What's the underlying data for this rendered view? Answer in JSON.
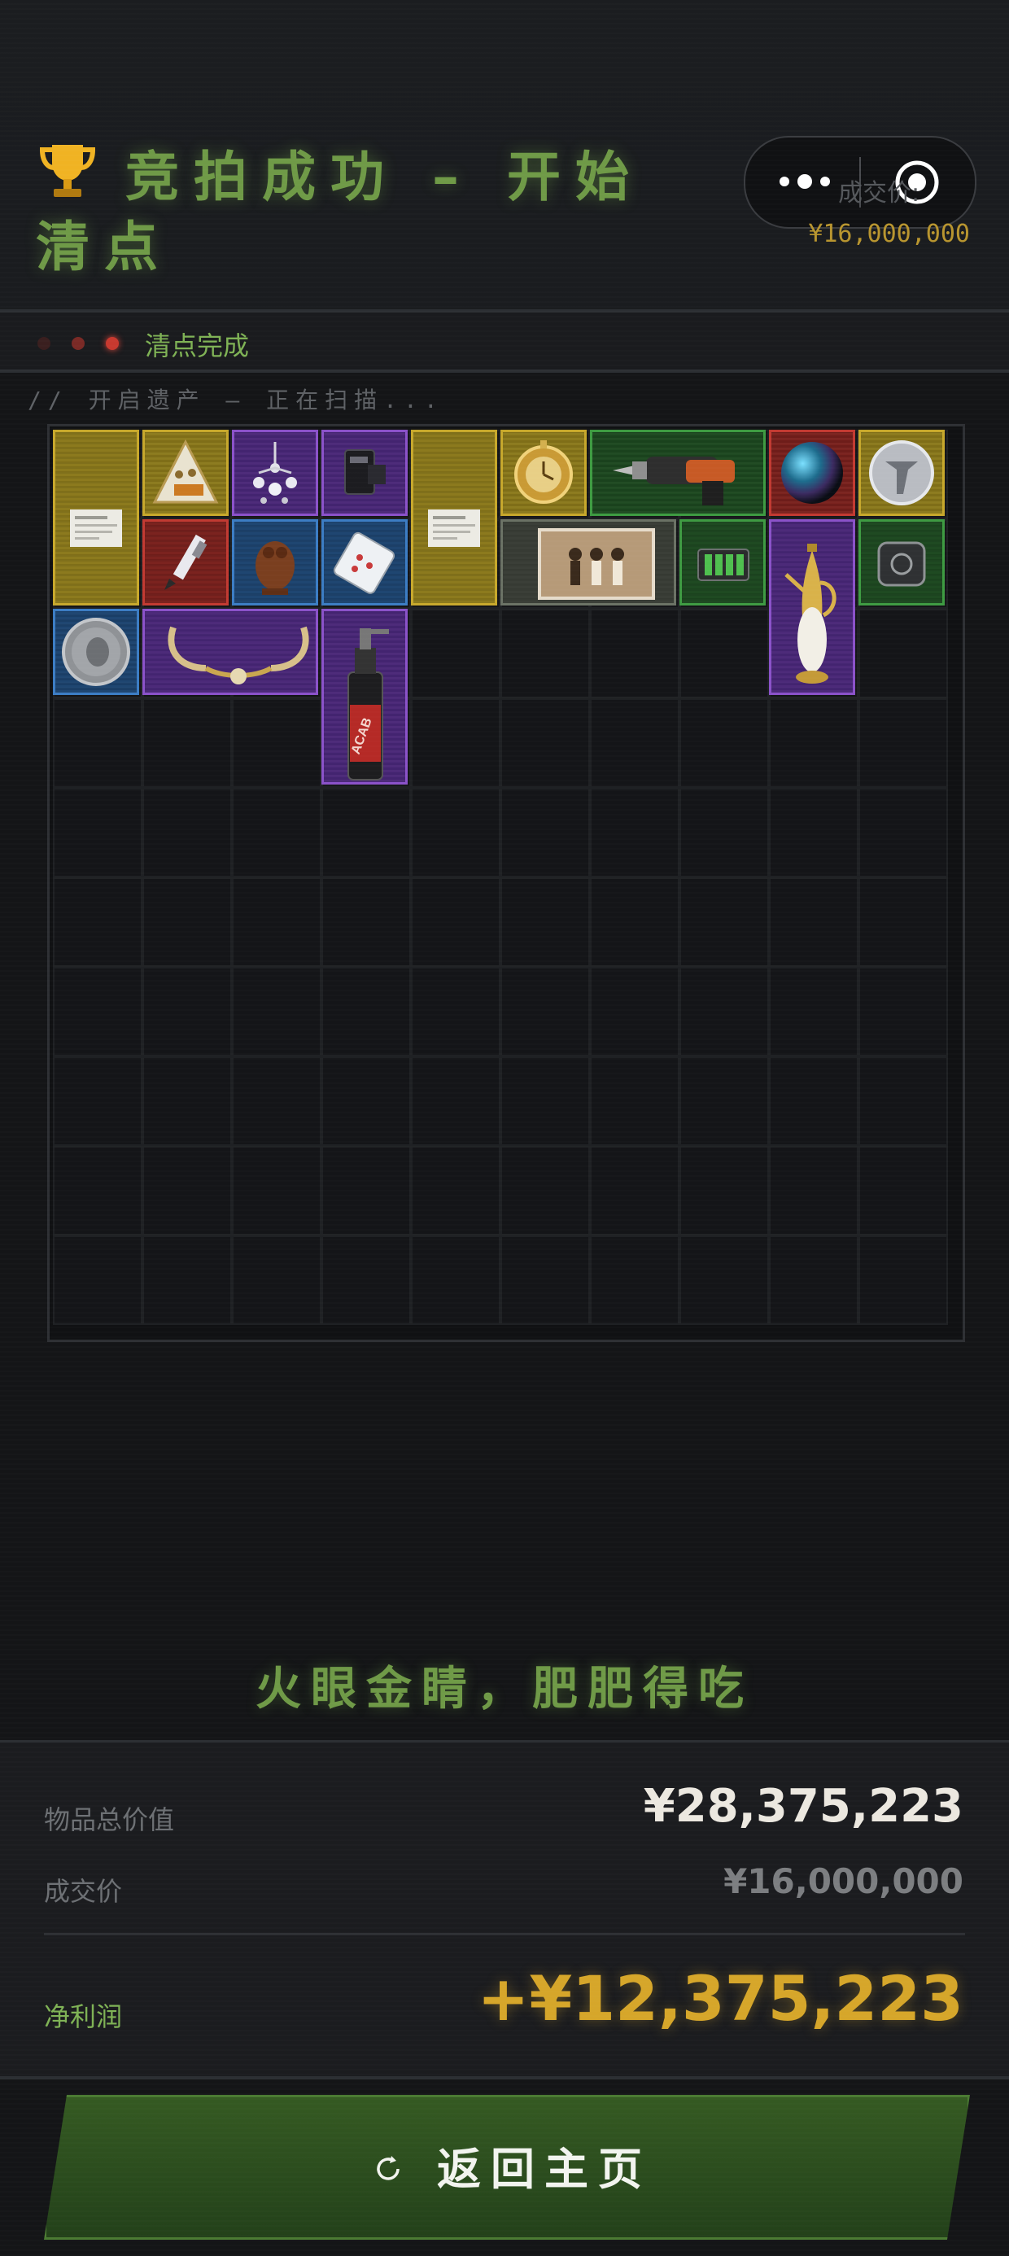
{
  "header": {
    "title": "竞拍成功 – 开始清点",
    "deal_label": "成交价:",
    "deal_value": "¥16,000,000"
  },
  "status": {
    "text": "清点完成",
    "scan_text": "// 开启遗产 – 正在扫描..."
  },
  "grid": {
    "columns": 10,
    "rows": 10,
    "items": [
      {
        "name": "document-item",
        "rarity": "gold",
        "col": 0,
        "row": 0,
        "w": 1,
        "h": 2,
        "icon": "document-icon"
      },
      {
        "name": "cookie-box-item",
        "rarity": "gold",
        "col": 1,
        "row": 0,
        "w": 1,
        "h": 1,
        "icon": "cookie-box-icon"
      },
      {
        "name": "earrings-item",
        "rarity": "purple",
        "col": 2,
        "row": 0,
        "w": 1,
        "h": 1,
        "icon": "earrings-icon"
      },
      {
        "name": "gadget-item",
        "rarity": "purple",
        "col": 3,
        "row": 0,
        "w": 1,
        "h": 1,
        "icon": "gadget-icon"
      },
      {
        "name": "document-item-2",
        "rarity": "gold",
        "col": 4,
        "row": 0,
        "w": 1,
        "h": 2,
        "icon": "document-icon"
      },
      {
        "name": "pocket-watch-item",
        "rarity": "gold",
        "col": 5,
        "row": 0,
        "w": 1,
        "h": 1,
        "icon": "pocket-watch-icon"
      },
      {
        "name": "power-drill-item",
        "rarity": "green",
        "col": 6,
        "row": 0,
        "w": 2,
        "h": 1,
        "icon": "power-drill-icon"
      },
      {
        "name": "orb-item",
        "rarity": "red",
        "col": 8,
        "row": 0,
        "w": 1,
        "h": 1,
        "icon": "orb-icon"
      },
      {
        "name": "silver-token-item",
        "rarity": "gold",
        "col": 9,
        "row": 0,
        "w": 1,
        "h": 1,
        "icon": "token-icon"
      },
      {
        "name": "fountain-pen-item",
        "rarity": "red",
        "col": 1,
        "row": 1,
        "w": 1,
        "h": 1,
        "icon": "pen-icon"
      },
      {
        "name": "owl-figurine-item",
        "rarity": "blue",
        "col": 2,
        "row": 1,
        "w": 1,
        "h": 1,
        "icon": "owl-icon"
      },
      {
        "name": "pill-pack-item",
        "rarity": "blue",
        "col": 3,
        "row": 1,
        "w": 1,
        "h": 1,
        "icon": "pill-pack-icon"
      },
      {
        "name": "old-photo-item",
        "rarity": "grey",
        "col": 5,
        "row": 1,
        "w": 2,
        "h": 1,
        "icon": "photo-icon"
      },
      {
        "name": "battery-item",
        "rarity": "green",
        "col": 7,
        "row": 1,
        "w": 1,
        "h": 1,
        "icon": "battery-icon"
      },
      {
        "name": "golden-ewer-item",
        "rarity": "purple",
        "col": 8,
        "row": 1,
        "w": 1,
        "h": 2,
        "icon": "ewer-icon"
      },
      {
        "name": "power-bank-item",
        "rarity": "green",
        "col": 9,
        "row": 1,
        "w": 1,
        "h": 1,
        "icon": "power-bank-icon"
      },
      {
        "name": "silver-coin-item",
        "rarity": "blue",
        "col": 0,
        "row": 2,
        "w": 1,
        "h": 1,
        "icon": "coin-icon"
      },
      {
        "name": "horn-necklace-item",
        "rarity": "purple",
        "col": 1,
        "row": 2,
        "w": 2,
        "h": 1,
        "icon": "horn-necklace-icon"
      },
      {
        "name": "torch-lighter-item",
        "rarity": "purple",
        "col": 3,
        "row": 2,
        "w": 1,
        "h": 2,
        "icon": "torch-icon",
        "text": "ACAB"
      }
    ]
  },
  "slogan": "火眼金睛，肥肥得吃",
  "summary": {
    "total_label": "物品总价值",
    "total_value": "¥28,375,223",
    "deal_label": "成交价",
    "deal_value": "¥16,000,000",
    "profit_label": "净利润",
    "profit_value": "+¥12,375,223"
  },
  "actions": {
    "home_label": "返回主页"
  },
  "colors": {
    "accent_green": "#6f9a47",
    "gold": "#d6a62a",
    "background": "#141517"
  }
}
